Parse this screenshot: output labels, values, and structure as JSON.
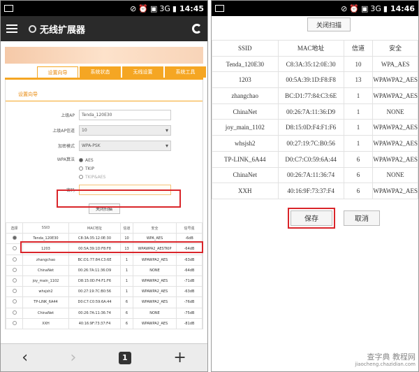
{
  "left": {
    "status": {
      "signal": "3G",
      "time": "14:45"
    },
    "app": {
      "title": "无线扩展器"
    },
    "tabs": [
      {
        "label": "设置向导"
      },
      {
        "label": "系统状态"
      },
      {
        "label": "无线设置"
      },
      {
        "label": "系统工具"
      }
    ],
    "section": "设置向导",
    "form": {
      "ap_label": "上级AP",
      "ap_value": "Tenda_120E30",
      "channel_label": "上级AP信道",
      "channel_value": "10",
      "encrypt_label": "加密模式",
      "encrypt_value": "WPA-PSK",
      "algo_label": "WPA算法",
      "algo_options": [
        "AES",
        "TKIP",
        "TKIP&AES"
      ],
      "password_label": "密码",
      "password_value": ""
    },
    "scan_button": "关闭扫描",
    "table": {
      "headers": [
        "选择",
        "SSID",
        "MAC地址",
        "信道",
        "安全",
        "信号强"
      ],
      "rows": [
        [
          "Tenda_120E30",
          "C8:3A:35:12:0E:30",
          "10",
          "WPA_AES",
          "-6dB"
        ],
        [
          "1203",
          "00:5A:39:1D:F8:F8",
          "13",
          "WPAWPA2_AESTKIP",
          "-64dB"
        ],
        [
          "zhangchao",
          "BC:D1:77:84:C3:6E",
          "1",
          "WPAWPA2_AES",
          "-63dB"
        ],
        [
          "ChinaNet",
          "00:26:7A:11:36:D9",
          "1",
          "NONE",
          "-64dB"
        ],
        [
          "joy_main_1102",
          "D8:15:0D:F4:F1:F6",
          "1",
          "WPAWPA2_AES",
          "-71dB"
        ],
        [
          "whsjsh2",
          "00:27:19:7C:B0:56",
          "1",
          "WPAWPA2_AES",
          "-63dB"
        ],
        [
          "TP-LINK_6A44",
          "D0:C7:C0:59:6A:44",
          "6",
          "WPAWPA2_AES",
          "-76dB"
        ],
        [
          "ChinaNet",
          "00:26:7A:11:36:74",
          "6",
          "NONE",
          "-75dB"
        ],
        [
          "XXH",
          "40:16:9F:73:37:F4",
          "6",
          "WPAWPA2_AES",
          "-81dB"
        ]
      ]
    },
    "nav": {
      "tabs_count": "1"
    }
  },
  "right": {
    "status": {
      "signal": "3G",
      "time": "14:46"
    },
    "scan_button": "关闭扫描",
    "table": {
      "headers": [
        "SSID",
        "MAC地址",
        "信道",
        "安全"
      ],
      "rows": [
        [
          "Tenda_120E30",
          "C8:3A:35:12:0E:30",
          "10",
          "WPA_AES"
        ],
        [
          "1203",
          "00:5A:39:1D:F8:F8",
          "13",
          "WPAWPA2_AES"
        ],
        [
          "zhangchao",
          "BC:D1:77:84:C3:6E",
          "1",
          "WPAWPA2_AES"
        ],
        [
          "ChinaNet",
          "00:26:7A:11:36:D9",
          "1",
          "NONE"
        ],
        [
          "joy_main_1102",
          "D8:15:0D:F4:F1:F6",
          "1",
          "WPAWPA2_AES"
        ],
        [
          "whsjsh2",
          "00:27:19:7C:B0:56",
          "1",
          "WPAWPA2_AES"
        ],
        [
          "TP-LINK_6A44",
          "D0:C7:C0:59:6A:44",
          "6",
          "WPAWPA2_AES"
        ],
        [
          "ChinaNet",
          "00:26:7A:11:36:74",
          "6",
          "NONE"
        ],
        [
          "XXH",
          "40:16:9F:73:37:F4",
          "6",
          "WPAWPA2_AES"
        ]
      ]
    },
    "save_button": "保存",
    "cancel_button": "取消"
  },
  "watermark": {
    "main": "查字典 教程网",
    "sub": "jiaocheng.chazidian.com"
  },
  "colors": {
    "accent": "#f5a623",
    "highlight": "#d9252a"
  }
}
